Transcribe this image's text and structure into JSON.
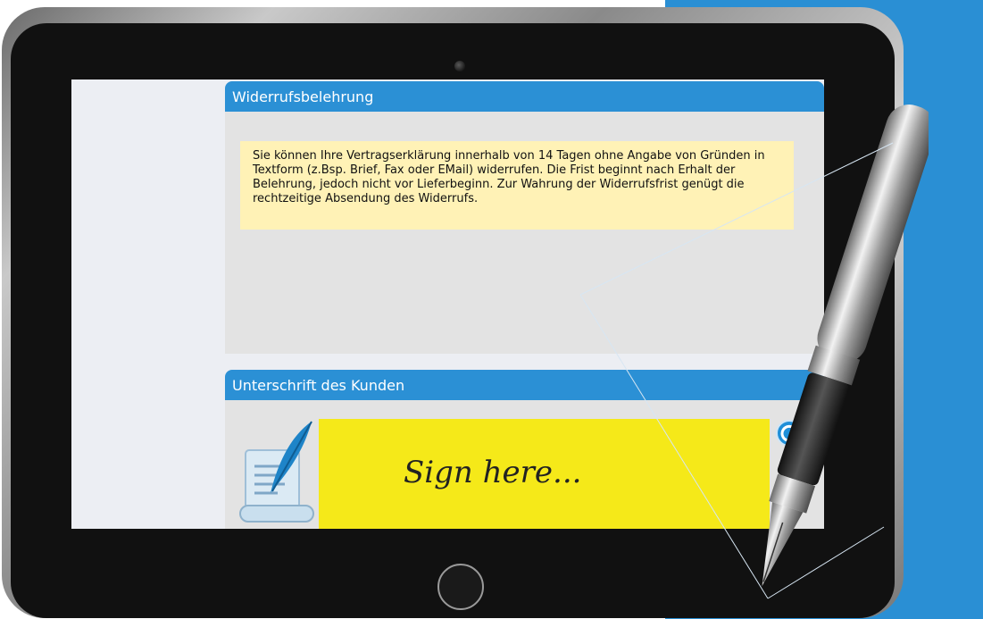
{
  "panels": {
    "notice": {
      "title": "Widerrufsbelehrung",
      "text": "Sie können Ihre Vertragserklärung innerhalb von 14 Tagen ohne Angabe von Gründen in Textform (z.Bsp. Brief, Fax oder EMail) widerrufen. Die Frist beginnt nach Erhalt der Belehrung, jedoch nicht vor Lieferbeginn. Zur Wahrung der Widerrufsfrist genügt die rechtzeitige Absendung des Widerrufs."
    },
    "signature": {
      "title": "Unterschrift des Kunden",
      "placeholder": "Sign here..."
    }
  },
  "icons": {
    "document": "quill-document-icon",
    "refresh": "refresh-icon",
    "pen": "fountain-pen-icon"
  },
  "colors": {
    "header_blue": "#2b90d5",
    "notice_bg": "#fff2b6",
    "signature_bg": "#f5e919",
    "side_blue": "#2a8fd4"
  }
}
